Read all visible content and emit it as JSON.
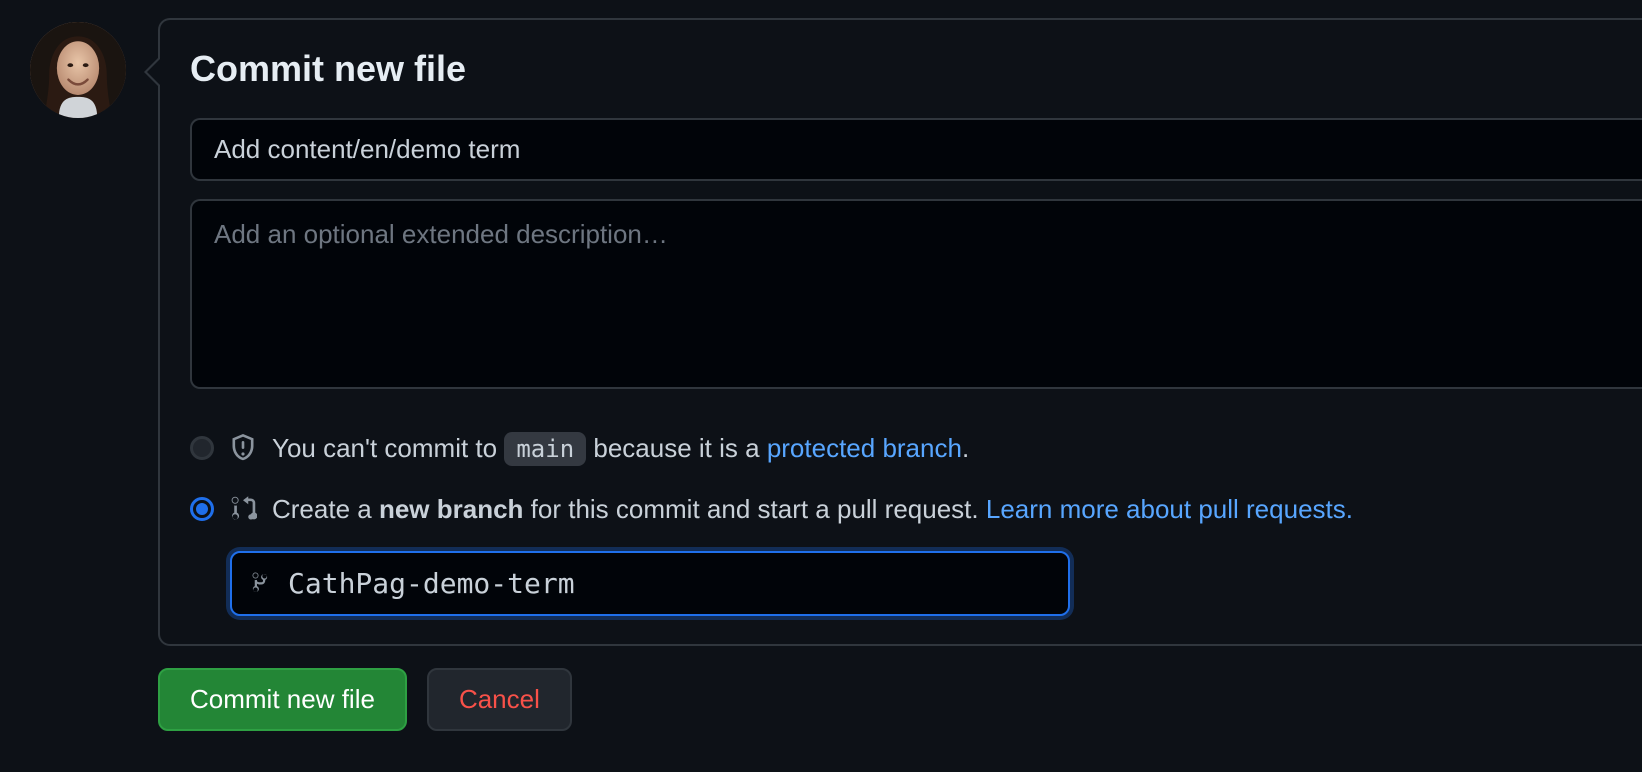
{
  "title": "Commit new file",
  "commit_summary": "Add content/en/demo term",
  "description_placeholder": "Add an optional extended description…",
  "description_value": "",
  "protected_option": {
    "prefix": "You can't commit to ",
    "branch": "main",
    "middle": " because it is a ",
    "link_text": "protected branch",
    "suffix": "."
  },
  "new_branch_option": {
    "prefix": "Create a ",
    "bold": "new branch",
    "middle": " for this commit and start a pull request. ",
    "link_text": "Learn more about pull requests."
  },
  "branch_name": "CathPag-demo-term",
  "buttons": {
    "commit": "Commit new file",
    "cancel": "Cancel"
  }
}
